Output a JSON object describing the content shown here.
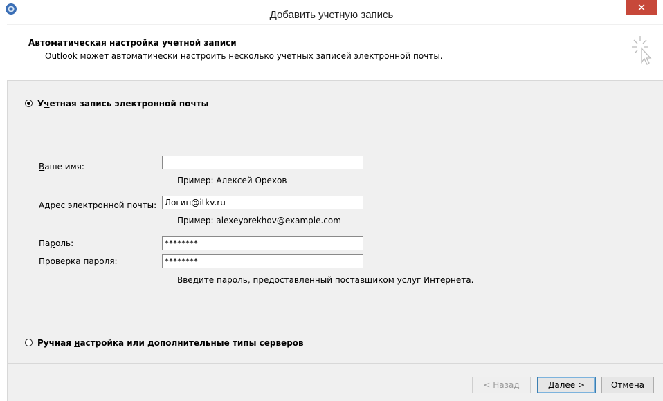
{
  "window": {
    "title": "Добавить учетную запись",
    "close_glyph": "✕"
  },
  "header": {
    "title": "Автоматическая настройка учетной записи",
    "subtitle": "Outlook может автоматически настроить несколько учетных записей электронной почты."
  },
  "options": {
    "email_account": {
      "label_pre": "У",
      "label_u": "ч",
      "label_post": "етная запись электронной почты",
      "selected": true
    },
    "manual": {
      "label_pre": "Ручная ",
      "label_u": "н",
      "label_post": "астройка или дополнительные типы серверов",
      "selected": false
    }
  },
  "form": {
    "name": {
      "label_u": "В",
      "label_post": "аше имя:",
      "value": "",
      "hint": "Пример: Алексей Орехов"
    },
    "email": {
      "label_pre": "Адрес ",
      "label_u": "э",
      "label_post": "лектронной почты:",
      "value": "Логин@itkv.ru",
      "hint": "Пример: alexeyorekhov@example.com"
    },
    "password": {
      "label_pre": "Па",
      "label_u": "р",
      "label_post": "оль:",
      "value": "********"
    },
    "password_confirm": {
      "label_pre": "Проверка парол",
      "label_u": "я",
      "label_post": ":",
      "value": "********",
      "hint": "Введите пароль, предоставленный поставщиком услуг Интернета."
    }
  },
  "buttons": {
    "back": {
      "pre": "< ",
      "u": "Н",
      "post": "азад",
      "enabled": false
    },
    "next": {
      "pre": "",
      "u": "Д",
      "post": "алее >",
      "enabled": true
    },
    "cancel": {
      "label": "Отмена"
    }
  },
  "icons": {
    "app": "outlook-app-icon",
    "header": "cursor-sparkle-icon"
  }
}
